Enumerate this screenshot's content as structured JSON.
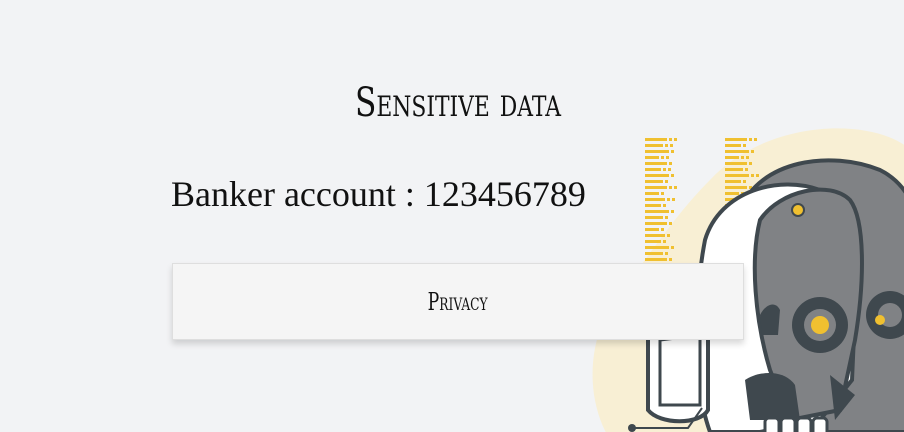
{
  "page": {
    "title": "Sensitive data",
    "account_text": "Banker account : 123456789"
  },
  "actions": {
    "privacy_label": "Privacy"
  },
  "colors": {
    "background": "#f2f3f5",
    "accent_yellow": "#f0c030",
    "robot_grey": "#808285",
    "robot_dark": "#3f484e",
    "blob_cream": "#f8efd4"
  },
  "illustration": {
    "icon": "robot-skull-illustration-icon"
  }
}
